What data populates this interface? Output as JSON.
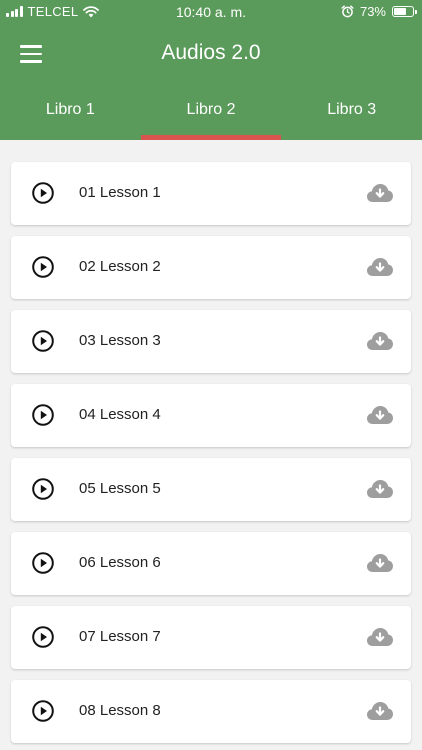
{
  "status_bar": {
    "carrier": "TELCEL",
    "time": "10:40 a. m.",
    "battery": "73%",
    "battery_level": 0.73
  },
  "app_bar": {
    "title": "Audios 2.0",
    "menu_icon": "hamburger-menu-icon"
  },
  "tabs": [
    {
      "label": "Libro 1",
      "active": false
    },
    {
      "label": "Libro 2",
      "active": true
    },
    {
      "label": "Libro 3",
      "active": false
    }
  ],
  "colors": {
    "primary": "#5a9a5a",
    "tab_indicator": "#d9534f",
    "background": "#f2f2f2",
    "card": "#ffffff",
    "download_icon": "#9e9e9e"
  },
  "lessons": [
    {
      "label": "01 Lesson 1",
      "play_icon": "play-circle-icon",
      "download_icon": "cloud-download-icon"
    },
    {
      "label": "02 Lesson 2",
      "play_icon": "play-circle-icon",
      "download_icon": "cloud-download-icon"
    },
    {
      "label": "03 Lesson 3",
      "play_icon": "play-circle-icon",
      "download_icon": "cloud-download-icon"
    },
    {
      "label": "04 Lesson 4",
      "play_icon": "play-circle-icon",
      "download_icon": "cloud-download-icon"
    },
    {
      "label": "05 Lesson 5",
      "play_icon": "play-circle-icon",
      "download_icon": "cloud-download-icon"
    },
    {
      "label": "06 Lesson 6",
      "play_icon": "play-circle-icon",
      "download_icon": "cloud-download-icon"
    },
    {
      "label": "07 Lesson 7",
      "play_icon": "play-circle-icon",
      "download_icon": "cloud-download-icon"
    },
    {
      "label": "08 Lesson 8",
      "play_icon": "play-circle-icon",
      "download_icon": "cloud-download-icon"
    }
  ]
}
